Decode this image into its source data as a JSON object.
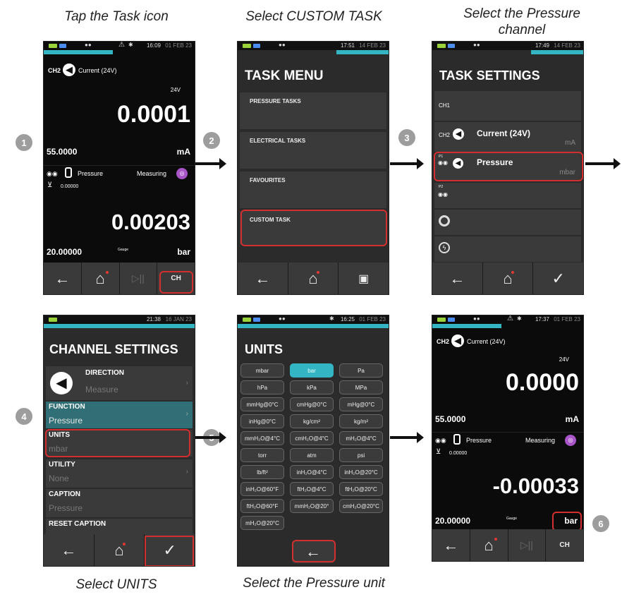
{
  "captions": {
    "c1": "Tap the Task icon",
    "c2": "Select CUSTOM TASK",
    "c3": "Select the Pressure channel",
    "c4": "Select UNITS",
    "c5": "Select the Pressure unit"
  },
  "steps": [
    "1",
    "2",
    "3",
    "4",
    "5",
    "6"
  ],
  "s1": {
    "time": "16:09",
    "date": "01 FEB 23",
    "ch2_label": "CH2",
    "ch2_name": "Current (24V)",
    "ch2_unit_top": "24V",
    "ch2_value": "0.0001",
    "ch2_range": "55.0000",
    "ch2_unit": "mA",
    "pr_name": "Pressure",
    "pr_status": "Measuring",
    "pr_zero": "0.00000",
    "pr_value": "0.00203",
    "pr_range": "20.00000",
    "pr_type": "Gauge",
    "pr_unit": "bar",
    "task_label": "CH"
  },
  "s2": {
    "time": "17:51",
    "date": "14 FEB 23",
    "title": "TASK MENU",
    "items": [
      "PRESSURE TASKS",
      "ELECTRICAL TASKS",
      "FAVOURITES",
      "CUSTOM TASK"
    ]
  },
  "s3": {
    "time": "17:49",
    "date": "14 FEB 23",
    "title": "TASK SETTINGS",
    "ch1": "CH1",
    "ch2_label": "CH2",
    "ch2_name": "Current (24V)",
    "ch2_unit": "mA",
    "p1_label": "P1",
    "pr_name": "Pressure",
    "pr_unit": "mbar",
    "p2_label": "P2"
  },
  "s4": {
    "time": "21:38",
    "date": "16 JAN 23",
    "title": "CHANNEL SETTINGS",
    "rows": [
      {
        "h": "DIRECTION",
        "v": "Measure"
      },
      {
        "h": "FUNCTION",
        "v": "Pressure"
      },
      {
        "h": "UNITS",
        "v": "mbar"
      },
      {
        "h": "UTILITY",
        "v": "None"
      },
      {
        "h": "CAPTION",
        "v": "Pressure"
      },
      {
        "h": "RESET CAPTION",
        "v": ""
      }
    ]
  },
  "s5": {
    "time": "16:25",
    "date": "01 FEB 23",
    "title": "UNITS",
    "units": [
      "mbar",
      "bar",
      "Pa",
      "hPa",
      "kPa",
      "MPa",
      "mmHg@0°C",
      "cmHg@0°C",
      "mHg@0°C",
      "inHg@0°C",
      "kg/cm²",
      "kg/m²",
      "mmH₂O@4°C",
      "cmH₂O@4°C",
      "mH₂O@4°C",
      "torr",
      "atm",
      "psi",
      "lb/ft²",
      "inH₂O@4°C",
      "inH₂O@20°C",
      "inH₂O@60°F",
      "ftH₂O@4°C",
      "ftH₂O@20°C",
      "ftH₂O@60°F",
      "mmH₂O@20°",
      "cmH₂O@20°C",
      "mH₂O@20°C"
    ],
    "selected": "bar"
  },
  "s6": {
    "time": "17:37",
    "date": "01 FEB 23",
    "ch2_label": "CH2",
    "ch2_name": "Current (24V)",
    "ch2_unit_top": "24V",
    "ch2_value": "0.0000",
    "ch2_range": "55.0000",
    "ch2_unit": "mA",
    "pr_name": "Pressure",
    "pr_status": "Measuring",
    "pr_zero": "0.00000",
    "pr_value": "-0.00033",
    "pr_range": "20.00000",
    "pr_type": "Gauge",
    "pr_unit": "bar",
    "task_label": "CH"
  },
  "colors": {
    "accent": "#34b5c4",
    "highlight": "#d32f2f",
    "measuring": "#a855c7"
  },
  "icons": [
    "back-arrow-icon",
    "home-icon",
    "play-pause-icon",
    "task-icon",
    "save-icon",
    "check-icon",
    "direction-icon",
    "sensor-icon",
    "transducer-icon",
    "zero-icon"
  ]
}
